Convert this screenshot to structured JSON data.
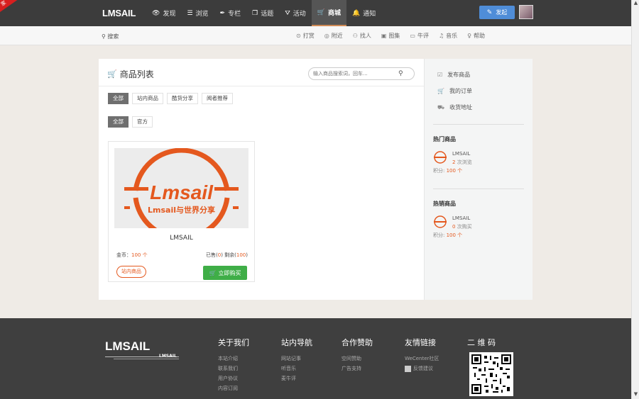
{
  "header": {
    "corner_ribbon": "家",
    "logo": "LMSAIL",
    "nav": [
      {
        "icon": "eye-icon",
        "glyph": "👁",
        "label": "发现"
      },
      {
        "icon": "list-icon",
        "glyph": "☰",
        "label": "浏览"
      },
      {
        "icon": "pen-icon",
        "glyph": "✒",
        "label": "专栏"
      },
      {
        "icon": "topic-icon",
        "glyph": "❐",
        "label": "话题"
      },
      {
        "icon": "activity-icon",
        "glyph": "⛛",
        "label": "活动"
      },
      {
        "icon": "cart-icon",
        "glyph": "🛒",
        "label": "商城",
        "active": true
      },
      {
        "icon": "bell-icon",
        "glyph": "🔔",
        "label": "通知"
      }
    ],
    "publish_label": "发起"
  },
  "subbar": {
    "search_label": "搜索",
    "links": [
      {
        "icon": "reward-icon",
        "glyph": "⊙",
        "label": "打赏"
      },
      {
        "icon": "nearby-icon",
        "glyph": "◎",
        "label": "附近"
      },
      {
        "icon": "people-icon",
        "glyph": "⚇",
        "label": "找人"
      },
      {
        "icon": "image-icon",
        "glyph": "▣",
        "label": "图集"
      },
      {
        "icon": "comment-icon",
        "glyph": "▭",
        "label": "牛评"
      },
      {
        "icon": "headphones-icon",
        "glyph": "♫",
        "label": "音乐"
      },
      {
        "icon": "help-icon",
        "glyph": "♀",
        "label": "帮助"
      }
    ]
  },
  "main": {
    "title": "商品列表",
    "search_placeholder": "输入商品搜索词，回车...",
    "filter_row_1": [
      {
        "label": "全部",
        "active": true
      },
      {
        "label": "站内商品"
      },
      {
        "label": "酷货分享"
      },
      {
        "label": "阅者推荐"
      }
    ],
    "filter_row_2": [
      {
        "label": "全部",
        "active": true
      },
      {
        "label": "官方"
      }
    ],
    "product": {
      "image_text": "Lmsail",
      "image_slogan": "Lmsail与世界分享",
      "name": "LMSAIL",
      "price_label": "金币：",
      "price_value": "100 个",
      "sold_label": "已售(",
      "sold_value": "0",
      "stock_label": ") 剩余(",
      "stock_value": "100",
      "stock_end": ")",
      "tag": "站内商品",
      "buy_label": "立即购买"
    }
  },
  "sidebar": {
    "links": [
      {
        "icon": "edit-icon",
        "glyph": "☑",
        "label": "发布商品"
      },
      {
        "icon": "cart-icon",
        "glyph": "🛒",
        "label": "我的订单"
      },
      {
        "icon": "truck-icon",
        "glyph": "⛟",
        "label": "收货地址"
      }
    ],
    "hot": {
      "heading": "热门商品",
      "name": "LMSAIL",
      "stat_value": "2",
      "stat_label": " 次浏览",
      "points_label": "积分: ",
      "points_value": "100 个"
    },
    "best": {
      "heading": "热销商品",
      "name": "LMSAIL",
      "stat_value": "0",
      "stat_label": " 次购买",
      "points_label": "积分: ",
      "points_value": "100 个"
    }
  },
  "footer": {
    "logo": "LMSAIL",
    "logo_sub": "LMSAIL",
    "columns": [
      {
        "title": "关于我们",
        "links": [
          "本站介绍",
          "联系我们",
          "用户协议",
          "内容订阅"
        ]
      },
      {
        "title": "站内导航",
        "links": [
          "网站记事",
          "听音乐",
          "麦牛评"
        ]
      },
      {
        "title": "合作赞助",
        "links": [
          "空间赞助",
          "广告支持"
        ]
      },
      {
        "title": "友情链接",
        "links": [
          "WeCenter社区",
          "反馈建议"
        ]
      },
      {
        "title": "二 维 码",
        "links": []
      }
    ]
  },
  "colors": {
    "topbar": "#3c3c3c",
    "accent_orange": "#e4581e",
    "buy_green": "#3fae47",
    "publish_blue": "#4f8dd8"
  }
}
